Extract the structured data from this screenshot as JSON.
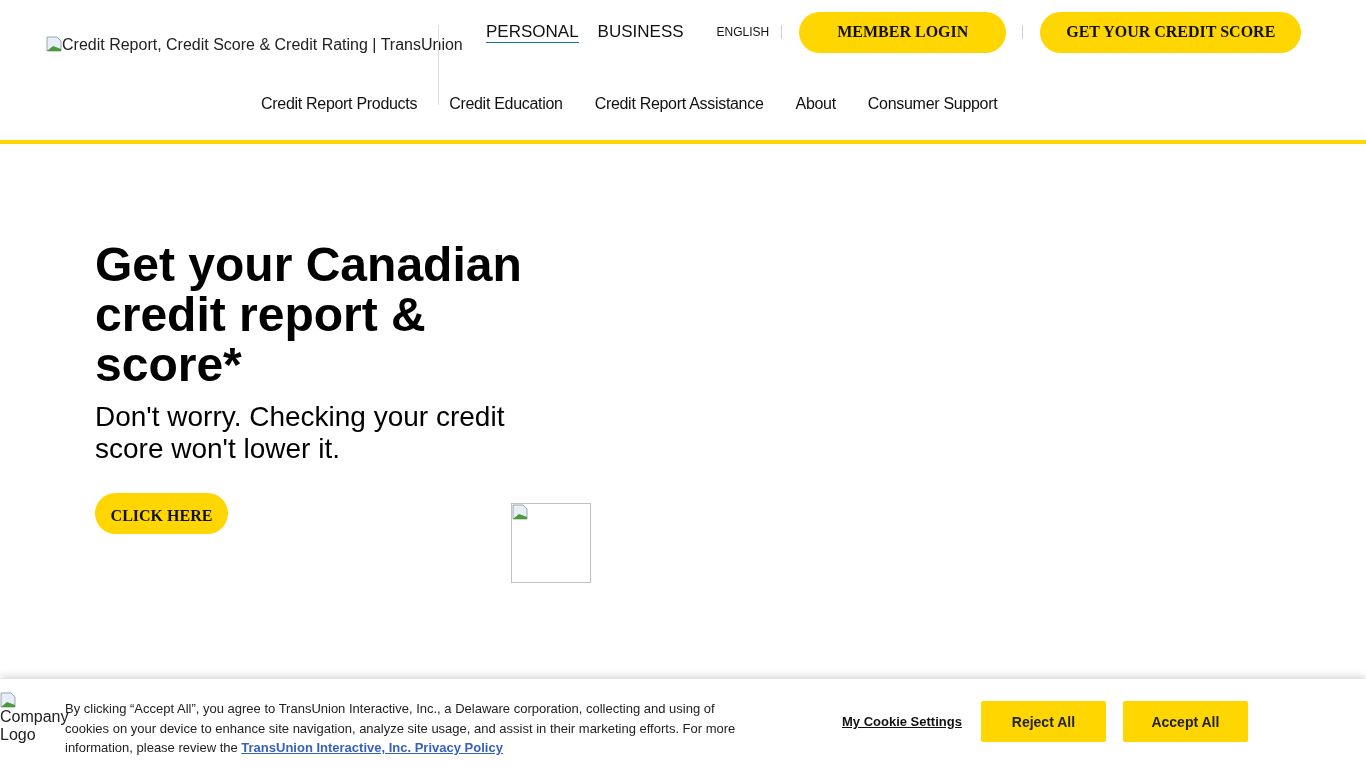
{
  "header": {
    "logo_alt": "Credit Report, Credit Score & Credit Rating | TransUnion",
    "segments": [
      {
        "label": "PERSONAL",
        "selected": true
      },
      {
        "label": "BUSINESS",
        "selected": false
      }
    ],
    "language": "ENGLISH",
    "buttons": [
      "MEMBER LOGIN",
      "GET YOUR CREDIT SCORE"
    ],
    "nav": [
      "Credit Report Products",
      "Credit Education",
      "Credit Report Assistance",
      "About",
      "Consumer Support"
    ]
  },
  "hero": {
    "title": "Get your Canadian credit report & score*",
    "subtitle": "Don't worry. Checking your credit score won't lower it.",
    "button": "CLICK HERE"
  },
  "cookie_banner": {
    "logo_alt": "Company Logo",
    "text": "By clicking “Accept All”, you agree to TransUnion Interactive, Inc., a Delaware corporation, collecting and using of cookies on your device to enhance site navigation, analyze site usage, and assist in their marketing efforts. For more information, please review the ",
    "link": "TransUnion Interactive, Inc. Privacy Policy",
    "settings": "My Cookie Settings",
    "buttons": [
      "Reject All",
      "Accept All"
    ]
  }
}
